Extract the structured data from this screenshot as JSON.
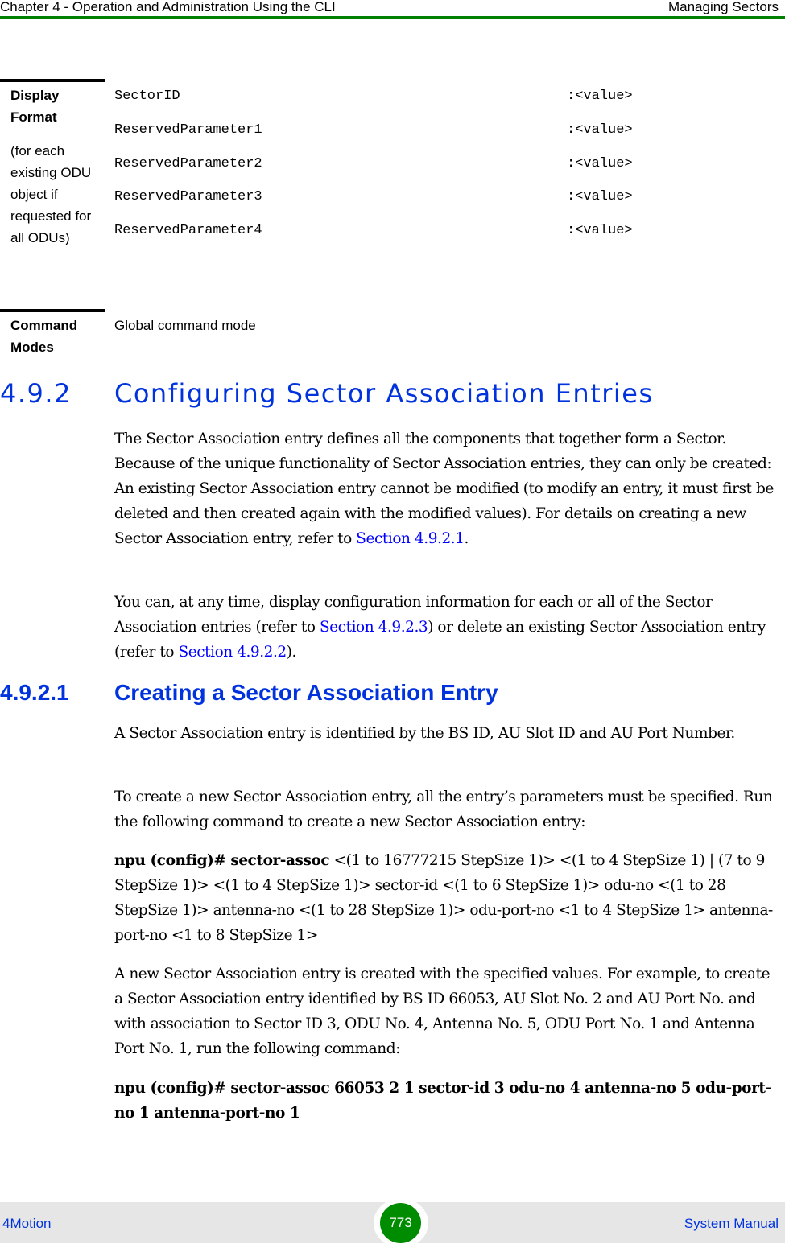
{
  "header": {
    "chapter_title": "Chapter 4 - Operation and Administration Using the CLI",
    "section_title": "Managing Sectors",
    "rule_color": "#008000"
  },
  "display_format": {
    "label_title": "Display Format",
    "label_note": "(for each existing ODU object if requested for all ODUs)",
    "rows": [
      {
        "key": "SectorID",
        "value": ":<value>"
      },
      {
        "key": "ReservedParameter1",
        "value": ":<value>"
      },
      {
        "key": "ReservedParameter2",
        "value": ":<value>"
      },
      {
        "key": "ReservedParameter3",
        "value": ":<value>"
      },
      {
        "key": "ReservedParameter4",
        "value": ":<value>"
      }
    ]
  },
  "command_modes": {
    "label": "Command Modes",
    "value": "Global command mode"
  },
  "section_492": {
    "number": "4.9.2",
    "title": "Configuring Sector Association Entries",
    "para1_text": "The Sector Association entry defines all the components that together form a Sector. Because of the unique functionality of Sector Association entries, they can only be created: An existing Sector Association entry cannot be modified (to modify an entry, it must first be deleted and then created again with the modified values). For details on creating a new Sector Association entry, refer to ",
    "para1_link": "Section 4.9.2.1",
    "para1_end": ".",
    "para2_a": "You can, at any time, display configuration information for each or all of the Sector Association entries (refer to ",
    "para2_link1": "Section 4.9.2.3",
    "para2_b": ") or delete an existing Sector Association entry (refer to ",
    "para2_link2": "Section 4.9.2.2",
    "para2_c": ")."
  },
  "section_4921": {
    "number": "4.9.2.1",
    "title": "Creating a Sector Association Entry",
    "para1": "A Sector Association entry is identified by the BS ID, AU Slot ID and AU Port Number.",
    "para2": "To create a new Sector Association entry, all the entry’s parameters must be specified. Run the following command to create a new Sector Association entry:",
    "syntax_bold": "npu (config)# sector-assoc",
    "syntax_rest": " <(1 to 16777215 StepSize 1)> <(1 to 4 StepSize 1) | (7 to 9 StepSize 1)> <(1 to 4 StepSize 1)> sector-id <(1 to 6 StepSize 1)> odu-no <(1 to 28 StepSize 1)> antenna-no <(1 to 28 StepSize 1)> odu-port-no <1 to 4 StepSize 1> antenna-port-no <1 to 8 StepSize 1>",
    "para3": "A new Sector Association entry is created with the specified values. For example, to create a Sector Association entry identified by BS ID 66053, AU Slot No. 2 and AU Port No. and with association to Sector ID 3, ODU No. 4, Antenna No. 5, ODU Port No. 1 and Antenna Port No. 1, run the following command:",
    "example_command": "npu (config)# sector-assoc 66053 2 1 sector-id 3 odu-no 4 antenna-no 5 odu-port-no 1 antenna-port-no 1"
  },
  "footer": {
    "product": "4Motion",
    "page_number": "773",
    "manual": "System Manual",
    "badge_color": "#008c00",
    "text_color": "#0033dd"
  }
}
